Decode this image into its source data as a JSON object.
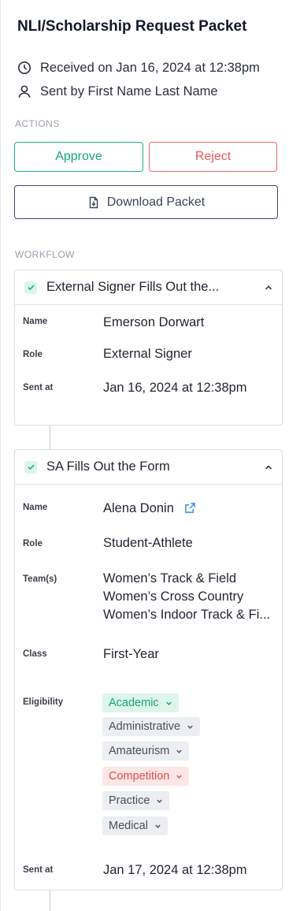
{
  "packet": {
    "title": "NLI/Scholarship Request Packet",
    "received": "Received on Jan 16, 2024 at 12:38pm",
    "sent_by": "Sent by First Name Last Name"
  },
  "actions": {
    "label": "ACTIONS",
    "approve_label": "Approve",
    "reject_label": "Reject",
    "download_label": "Download Packet"
  },
  "workflow": {
    "label": "WORKFLOW",
    "step1": {
      "title": "External Signer Fills Out the...",
      "fields": {
        "name_label": "Name",
        "name_value": "Emerson Dorwart",
        "role_label": "Role",
        "role_value": "External Signer",
        "sent_label": "Sent at",
        "sent_value": "Jan 16, 2024 at 12:38pm"
      }
    },
    "step2": {
      "title": "SA Fills Out the Form",
      "fields": {
        "name_label": "Name",
        "name_value": "Alena Donin",
        "role_label": "Role",
        "role_value": "Student-Athlete",
        "teams_label": "Team(s)",
        "teams": [
          "Women’s Track & Field",
          "Women’s Cross Country",
          "Women’s Indoor Track & Fi..."
        ],
        "class_label": "Class",
        "class_value": "First-Year",
        "eligibility_label": "Eligibility",
        "eligibility": [
          "Academic",
          "Administrative",
          "Amateurism",
          "Competition",
          "Practice",
          "Medical"
        ],
        "sent_label": "Sent at",
        "sent_value": "Jan 17, 2024 at 12:38pm"
      }
    }
  },
  "colors": {
    "approve": "#15a878",
    "reject": "#e25a5a",
    "tag_green_bg": "#def5ec",
    "tag_gray_bg": "#eceef1",
    "tag_red_bg": "#fde6e6",
    "link": "#2f8fe0"
  },
  "icons": {
    "received": "clock-icon",
    "sent_by": "user-icon",
    "download": "file-download-icon",
    "step_check": "check-icon",
    "collapse": "chevron-up-icon",
    "external": "external-link-icon",
    "tag_dropdown": "chevron-down-icon"
  }
}
